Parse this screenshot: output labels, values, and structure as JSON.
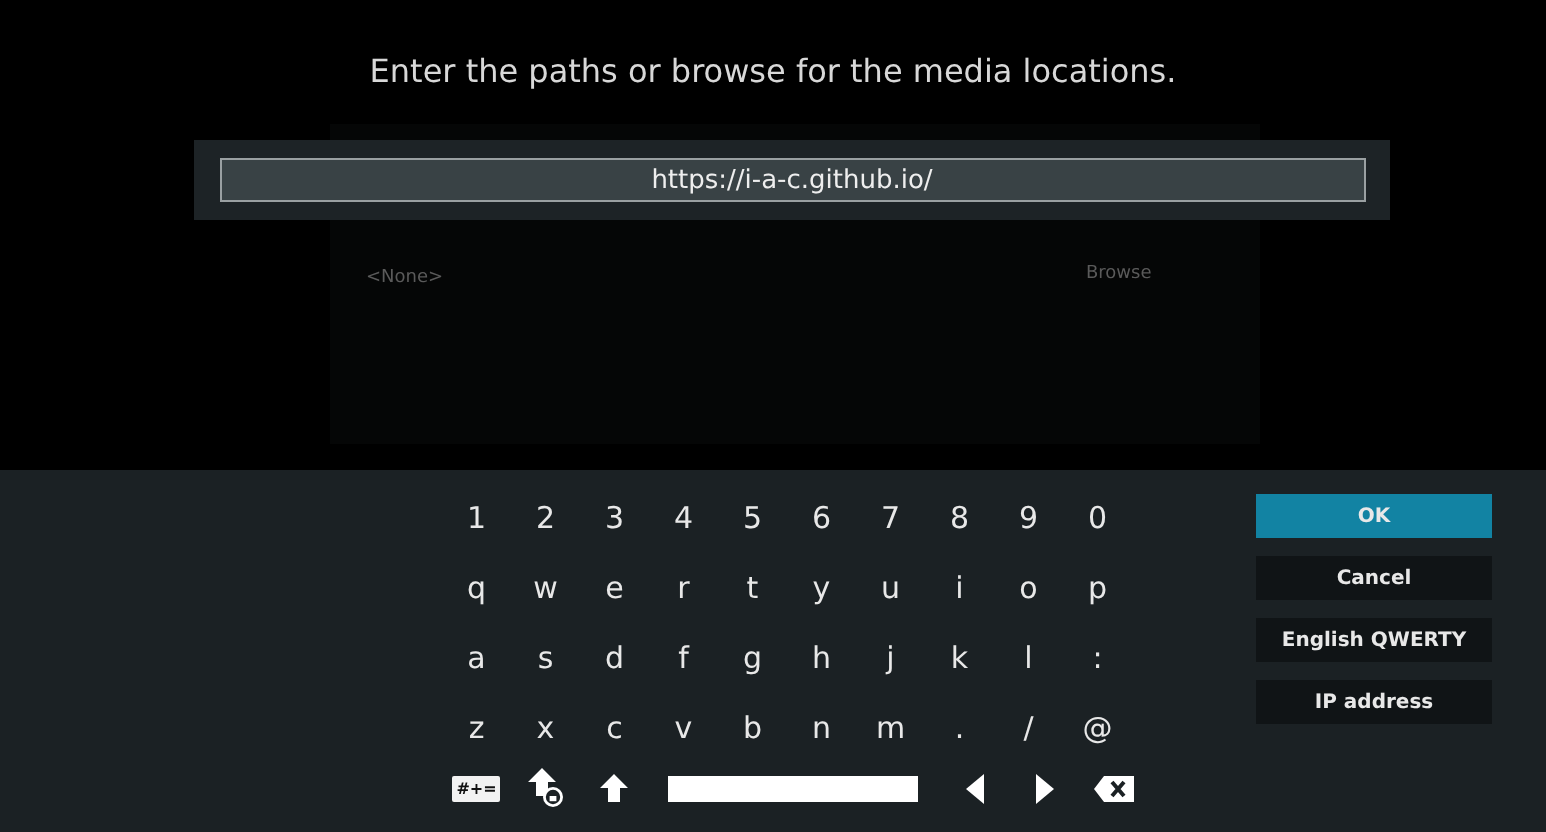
{
  "heading": "Enter the paths or browse for the media locations.",
  "input": {
    "value": "https://i-a-c.github.io/"
  },
  "background_dialog": {
    "path_label": "<None>",
    "browse_button": "Browse"
  },
  "keyboard": {
    "rows": [
      [
        "1",
        "2",
        "3",
        "4",
        "5",
        "6",
        "7",
        "8",
        "9",
        "0"
      ],
      [
        "q",
        "w",
        "e",
        "r",
        "t",
        "y",
        "u",
        "i",
        "o",
        "p"
      ],
      [
        "a",
        "s",
        "d",
        "f",
        "g",
        "h",
        "j",
        "k",
        "l",
        ":"
      ],
      [
        "z",
        "x",
        "c",
        "v",
        "b",
        "n",
        "m",
        ".",
        "/",
        "@"
      ]
    ],
    "bottom_keys": [
      {
        "kind": "symbols",
        "label": "#+="
      },
      {
        "kind": "caps"
      },
      {
        "kind": "shift"
      },
      {
        "kind": "space"
      },
      {
        "kind": "left"
      },
      {
        "kind": "right"
      },
      {
        "kind": "backspace"
      }
    ]
  },
  "buttons": [
    {
      "label": "OK",
      "selected": true
    },
    {
      "label": "Cancel",
      "selected": false
    },
    {
      "label": "English QWERTY",
      "selected": false
    },
    {
      "label": "IP address",
      "selected": false
    }
  ]
}
